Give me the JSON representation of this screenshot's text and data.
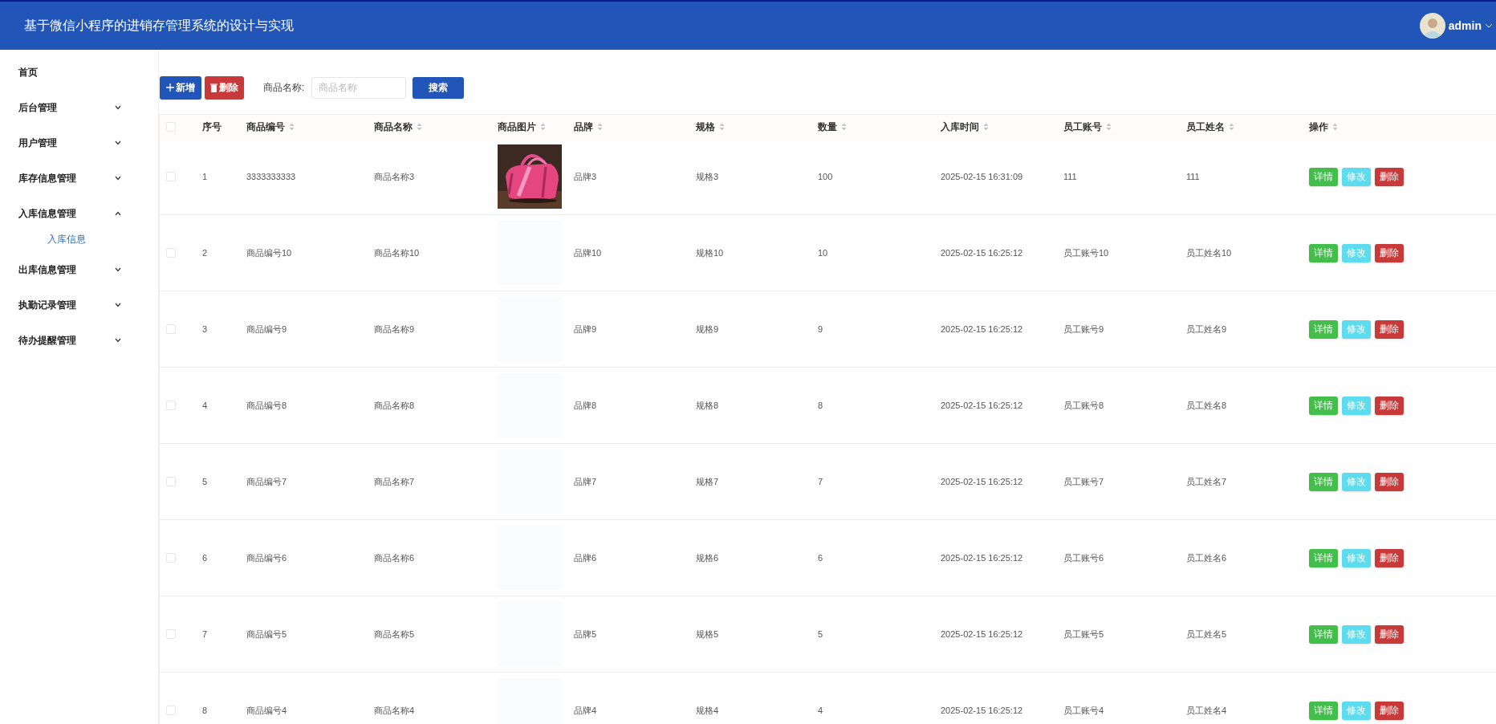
{
  "header": {
    "title": "基于微信小程序的进销存管理系统的设计与实现",
    "user": "admin"
  },
  "sidebar": {
    "items": [
      {
        "label": "首页",
        "kind": "link"
      },
      {
        "label": "后台管理",
        "kind": "group",
        "expanded": false
      },
      {
        "label": "用户管理",
        "kind": "group",
        "expanded": false
      },
      {
        "label": "库存信息管理",
        "kind": "group",
        "expanded": false
      },
      {
        "label": "入库信息管理",
        "kind": "group",
        "expanded": true,
        "children": [
          {
            "label": "入库信息",
            "selected": true
          }
        ]
      },
      {
        "label": "出库信息管理",
        "kind": "group",
        "expanded": false
      },
      {
        "label": "执勤记录管理",
        "kind": "group",
        "expanded": false
      },
      {
        "label": "待办提醒管理",
        "kind": "group",
        "expanded": false
      }
    ]
  },
  "toolbar": {
    "add_button": "新增",
    "delete_button": "删除",
    "search_label": "商品名称:",
    "search_placeholder": "商品名称",
    "search_button": "搜索"
  },
  "table": {
    "select_all_checked": false,
    "columns": [
      "序号",
      "商品编号",
      "商品名称",
      "商品图片",
      "品牌",
      "规格",
      "数量",
      "入库时间",
      "员工账号",
      "员工姓名",
      "操作"
    ],
    "rows": [
      {
        "checked": false,
        "cells": [
          "1",
          "3333333333",
          "商品名称3",
          null,
          "品牌3",
          "规格3",
          "100",
          "2025-02-15 16:31:09",
          "111",
          "111"
        ],
        "has_image": true,
        "actions": [
          "详情",
          "修改",
          "删除"
        ]
      },
      {
        "checked": false,
        "cells": [
          "2",
          "商品编号10",
          "商品名称10",
          null,
          "品牌10",
          "规格10",
          "10",
          "2025-02-15 16:25:12",
          "员工账号10",
          "员工姓名10"
        ],
        "has_image": false,
        "actions": [
          "详情",
          "修改",
          "删除"
        ]
      },
      {
        "checked": false,
        "cells": [
          "3",
          "商品编号9",
          "商品名称9",
          null,
          "品牌9",
          "规格9",
          "9",
          "2025-02-15 16:25:12",
          "员工账号9",
          "员工姓名9"
        ],
        "has_image": false,
        "actions": [
          "详情",
          "修改",
          "删除"
        ]
      },
      {
        "checked": false,
        "cells": [
          "4",
          "商品编号8",
          "商品名称8",
          null,
          "品牌8",
          "规格8",
          "8",
          "2025-02-15 16:25:12",
          "员工账号8",
          "员工姓名8"
        ],
        "has_image": false,
        "actions": [
          "详情",
          "修改",
          "删除"
        ]
      },
      {
        "checked": false,
        "cells": [
          "5",
          "商品编号7",
          "商品名称7",
          null,
          "品牌7",
          "规格7",
          "7",
          "2025-02-15 16:25:12",
          "员工账号7",
          "员工姓名7"
        ],
        "has_image": false,
        "actions": [
          "详情",
          "修改",
          "删除"
        ]
      },
      {
        "checked": false,
        "cells": [
          "6",
          "商品编号6",
          "商品名称6",
          null,
          "品牌6",
          "规格6",
          "6",
          "2025-02-15 16:25:12",
          "员工账号6",
          "员工姓名6"
        ],
        "has_image": false,
        "actions": [
          "详情",
          "修改",
          "删除"
        ]
      },
      {
        "checked": false,
        "cells": [
          "7",
          "商品编号5",
          "商品名称5",
          null,
          "品牌5",
          "规格5",
          "5",
          "2025-02-15 16:25:12",
          "员工账号5",
          "员工姓名5"
        ],
        "has_image": false,
        "actions": [
          "详情",
          "修改",
          "删除"
        ]
      },
      {
        "checked": false,
        "cells": [
          "8",
          "商品编号4",
          "商品名称4",
          null,
          "品牌4",
          "规格4",
          "4",
          "2025-02-15 16:25:12",
          "员工账号4",
          "员工姓名4"
        ],
        "has_image": false,
        "actions": [
          "详情",
          "修改",
          "删除"
        ]
      }
    ]
  }
}
